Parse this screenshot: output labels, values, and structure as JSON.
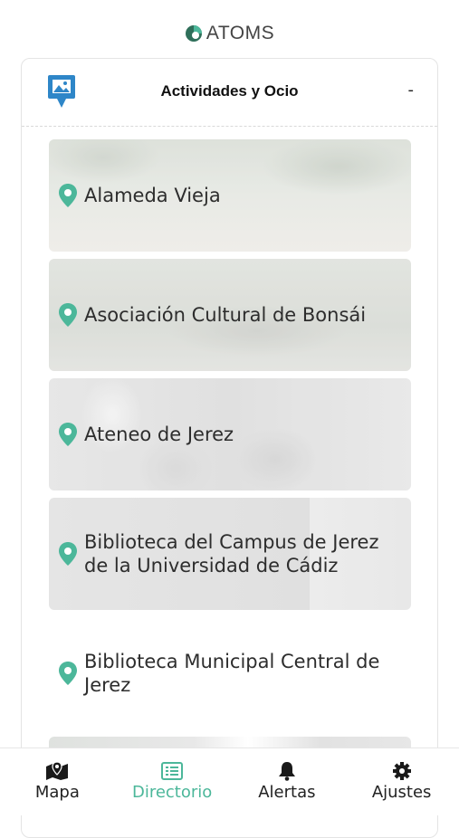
{
  "app": {
    "logo_text": "ATOMS"
  },
  "category": {
    "title": "Actividades y Ocio",
    "toggle": "-"
  },
  "items": [
    {
      "label": "Alameda Vieja"
    },
    {
      "label": "Asociación Cultural de Bonsái"
    },
    {
      "label": "Ateneo de Jerez"
    },
    {
      "label": "Biblioteca del Campus de Jerez de la Universidad de Cádiz"
    },
    {
      "label": "Biblioteca Municipal Central de Jerez"
    }
  ],
  "tabs": [
    {
      "label": "Mapa",
      "icon": "map-icon",
      "active": false
    },
    {
      "label": "Directorio",
      "icon": "list-icon",
      "active": true
    },
    {
      "label": "Alertas",
      "icon": "bell-icon",
      "active": false
    },
    {
      "label": "Ajustes",
      "icon": "gear-icon",
      "active": false
    }
  ],
  "colors": {
    "accent": "#4cb79a",
    "category_icon": "#2e86c8"
  }
}
